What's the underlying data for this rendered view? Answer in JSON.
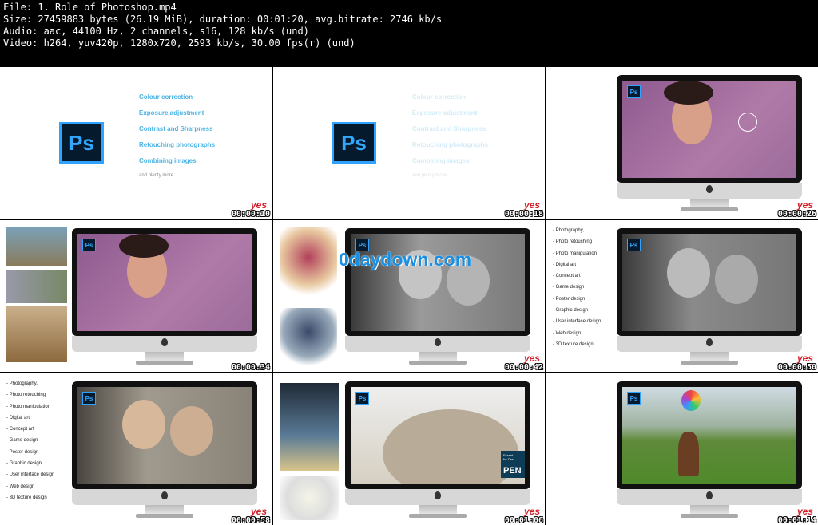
{
  "header": {
    "line1": "File: 1. Role of Photoshop.mp4",
    "line2": "Size: 27459883 bytes (26.19 MiB), duration: 00:01:20, avg.bitrate: 2746 kb/s",
    "line3": "Audio: aac, 44100 Hz, 2 channels, s16, 128 kb/s (und)",
    "line4": "Video: h264, yuv420p, 1280x720, 2593 kb/s, 30.00 fps(r) (und)"
  },
  "brand": "yes",
  "ps_logo": "Ps",
  "watermark": "0daydown.com",
  "menu_items": [
    "Colour correction",
    "Exposure adjustment",
    "Contrast and Sharpness",
    "Retouching photographs",
    "Combining images"
  ],
  "menu_more": "and plenty more...",
  "design_list": [
    "- Photography,",
    "- Photo retouching",
    "- Photo manipulation",
    "- Digital art",
    "- Concept art",
    "- Game design",
    "- Poster design",
    "- Graphic design",
    "- User interface design",
    "- Web design",
    "- 3D texture design"
  ],
  "pen_card": {
    "line1": "Essent",
    "line2": "for Desi",
    "title": "PEN"
  },
  "timestamps": [
    "00:00:10",
    "00:00:18",
    "00:00:26",
    "00:00:34",
    "00:00:42",
    "00:00:50",
    "00:00:58",
    "00:01:06",
    "00:01:14"
  ],
  "colors": {
    "ps_blue": "#31a8ff",
    "ps_dark": "#061a2d",
    "brand_red": "#d31f2a"
  }
}
